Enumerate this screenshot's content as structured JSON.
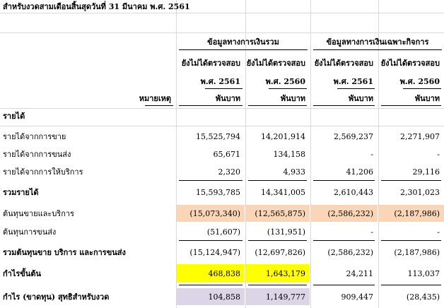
{
  "title": "สำหรับงวดสามเดือนสิ้นสุดวันที่ 31 มีนาคม พ.ศ. 2561",
  "groups": {
    "consolidated": "ข้อมูลทางการเงินรวม",
    "separate": "ข้อมูลทางการเงินเฉพาะกิจการ"
  },
  "unaudited": [
    "ยังไม่ได้ตรวจสอบ",
    "ยังไม่ได้ตรวจสอบ",
    "ยังไม่ได้ตรวจสอบ",
    "ยังไม่ได้ตรวจสอบ"
  ],
  "years": [
    "พ.ศ. 2561",
    "พ.ศ. 2560",
    "พ.ศ. 2561",
    "พ.ศ. 2560"
  ],
  "note_header": "หมายเหตุ",
  "units": [
    "พันบาท",
    "พันบาท",
    "พันบาท",
    "พันบาท"
  ],
  "section_revenue": "รายได้",
  "rows": [
    {
      "label": "รายได้จากการขาย",
      "values": [
        "15,525,794",
        "14,201,914",
        "2,569,237",
        "2,271,907"
      ]
    },
    {
      "label": "รายได้จากการขนส่ง",
      "values": [
        "65,671",
        "134,158",
        "-",
        "-"
      ]
    },
    {
      "label": "รายได้จากการให้บริการ",
      "values": [
        "2,320",
        "4,933",
        "41,206",
        "29,116"
      ]
    },
    {
      "label": "รวมรายได้",
      "values": [
        "15,593,785",
        "14,341,005",
        "2,610,443",
        "2,301,023"
      ]
    },
    {
      "label": "ต้นทุนขายและบริการ",
      "values": [
        "(15,073,340)",
        "(12,565,875)",
        "(2,586,232)",
        "(2,187,986)"
      ]
    },
    {
      "label": "ต้นทุนการขนส่ง",
      "values": [
        "(51,607)",
        "(131,951)",
        "-",
        "-"
      ]
    },
    {
      "label": "รวมต้นทุนขาย บริการ และการขนส่ง",
      "values": [
        "(15,124,947)",
        "(12,697,826)",
        "(2,586,232)",
        "(2,187,986)"
      ]
    },
    {
      "label": "กำไรขั้นต้น",
      "values": [
        "468,838",
        "1,643,179",
        "24,211",
        "113,037"
      ]
    },
    {
      "label": "กำไร (ขาดทุน) สุทธิสำหรับงวด",
      "values": [
        "104,858",
        "1,149,777",
        "909,447",
        "(28,435)"
      ]
    }
  ],
  "colors": {
    "peach": "#fbd5b5",
    "yellow": "#ffff00",
    "lilac": "#dcd5e8",
    "gridline": "#d9d9d9"
  }
}
